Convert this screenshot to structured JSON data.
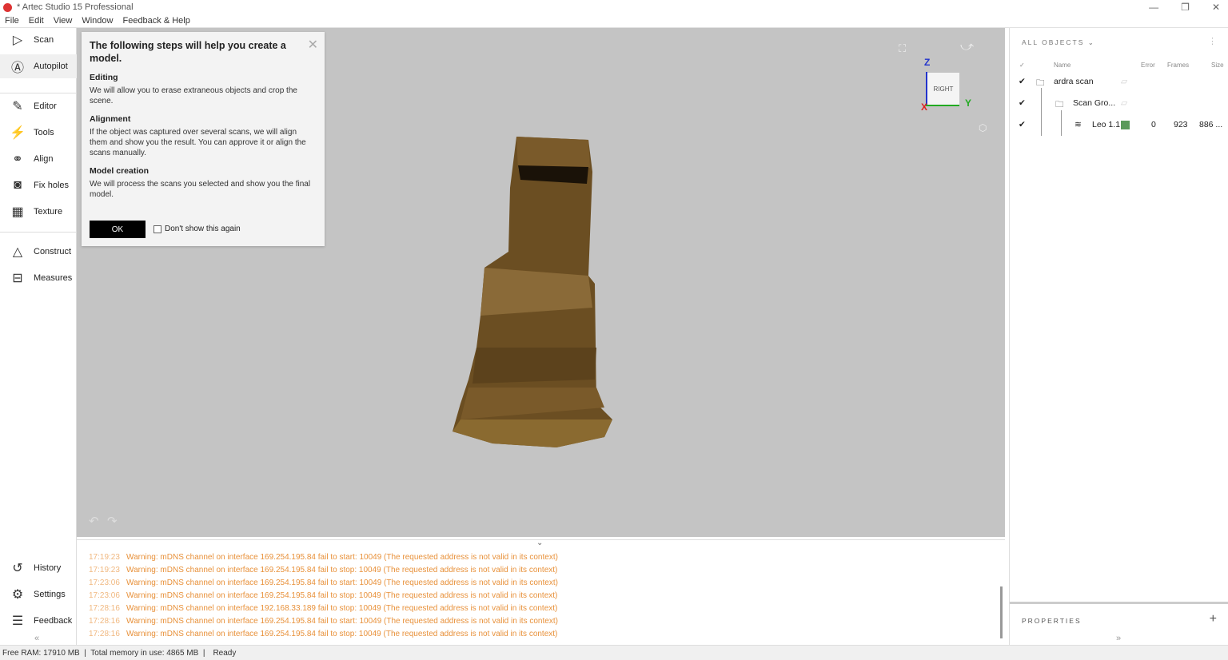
{
  "window": {
    "title": "* Artec Studio 15 Professional",
    "minimize": "—",
    "restore": "❐",
    "close": "✕"
  },
  "menu": [
    "File",
    "Edit",
    "View",
    "Window",
    "Feedback & Help"
  ],
  "sidebar": {
    "items": [
      {
        "label": "Scan",
        "icon": "▷"
      },
      {
        "label": "Autopilot",
        "icon": "Ⓐ"
      },
      {
        "label": "Editor",
        "icon": "✎"
      },
      {
        "label": "Tools",
        "icon": "⚡"
      },
      {
        "label": "Align",
        "icon": "⚭"
      },
      {
        "label": "Fix holes",
        "icon": "◙"
      },
      {
        "label": "Texture",
        "icon": "▦"
      },
      {
        "label": "Construct",
        "icon": "△"
      },
      {
        "label": "Measures",
        "icon": "⊟"
      },
      {
        "label": "History",
        "icon": "↺"
      },
      {
        "label": "Settings",
        "icon": "⚙"
      },
      {
        "label": "Feedback",
        "icon": "☰"
      }
    ],
    "collapse": "«"
  },
  "dialog": {
    "title": "The following steps will help you create a model.",
    "sections": [
      {
        "heading": "Editing",
        "text": "We will allow you to erase extraneous objects and crop the scene."
      },
      {
        "heading": "Alignment",
        "text": "If the object was captured over several scans, we will align them and show you the result. You can approve it or align the scans manually."
      },
      {
        "heading": "Model creation",
        "text": "We will process the scans you selected and show you the final model."
      }
    ],
    "ok": "OK",
    "checkbox": "Don't show this again",
    "close": "✕"
  },
  "viewcube": {
    "face": "RIGHT",
    "z": "Z",
    "y": "Y",
    "x": "X"
  },
  "log": {
    "toggle": "⌄",
    "lines": [
      {
        "time": "17:19:23",
        "msg": "Warning: mDNS channel on interface 169.254.195.84 fail to start: 10049 (The requested address is not valid in its context)"
      },
      {
        "time": "17:19:23",
        "msg": "Warning: mDNS channel on interface 169.254.195.84 fail to stop: 10049 (The requested address is not valid in its context)"
      },
      {
        "time": "17:23:06",
        "msg": "Warning: mDNS channel on interface 169.254.195.84 fail to start: 10049 (The requested address is not valid in its context)"
      },
      {
        "time": "17:23:06",
        "msg": "Warning: mDNS channel on interface 169.254.195.84 fail to stop: 10049 (The requested address is not valid in its context)"
      },
      {
        "time": "17:28:16",
        "msg": "Warning: mDNS channel on interface 192.168.33.189 fail to stop: 10049 (The requested address is not valid in its context)"
      },
      {
        "time": "17:28:16",
        "msg": "Warning: mDNS channel on interface 169.254.195.84 fail to start: 10049 (The requested address is not valid in its context)"
      },
      {
        "time": "17:28:16",
        "msg": "Warning: mDNS channel on interface 169.254.195.84 fail to stop: 10049 (The requested address is not valid in its context)"
      }
    ]
  },
  "objects": {
    "header": "ALL OBJECTS ⌄",
    "columns": {
      "check": "✓",
      "name": "Name",
      "error": "Error",
      "frames": "Frames",
      "size": "Size"
    },
    "rows": [
      {
        "name": "ardra scan",
        "check": "✔"
      },
      {
        "name": "Scan Gro...",
        "check": "✔"
      },
      {
        "name": "Leo 1.1",
        "check": "✔",
        "error": "0",
        "frames": "923",
        "size": "886 ...",
        "color": "#5a9a5a"
      }
    ]
  },
  "properties": {
    "title": "PROPERTIES",
    "add": "+",
    "expand": "»"
  },
  "status": {
    "free_ram": "Free RAM: 17910 MB  |  Total memory in use: 4865 MB  |",
    "state": "Ready"
  }
}
